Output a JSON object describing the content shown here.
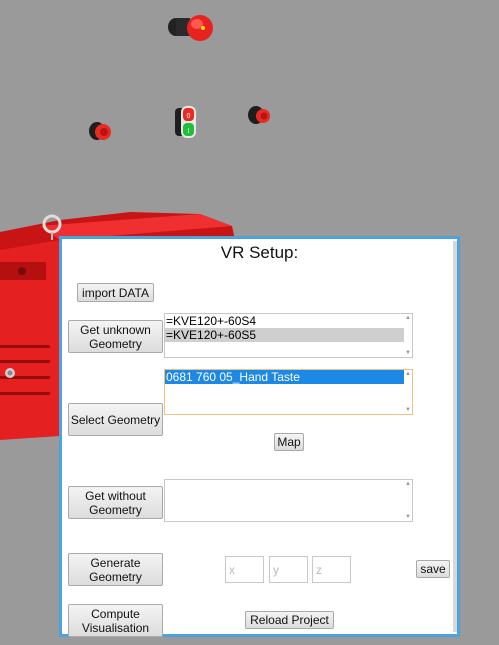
{
  "panel": {
    "title": "VR Setup:",
    "import_label": "import DATA",
    "get_unknown_label": "Get unknown Geometry",
    "unknown_items": [
      "=KVE120+-60S4",
      "=KVE120+-60S5"
    ],
    "select_label": "Select Geometry",
    "selected_items": [
      "0681 760 05_Hand Taste"
    ],
    "map_label": "Map",
    "get_without_label": "Get without Geometry",
    "without_items": [],
    "generate_label": "Generate Geometry",
    "x_placeholder": "x",
    "y_placeholder": "y",
    "z_placeholder": "z",
    "save_label": "save",
    "compute_label": "Compute Visualisation",
    "reload_label": "Reload Project"
  },
  "colors": {
    "scene_background": "#9a9a9a",
    "panel_border": "#4aa3df",
    "selection_blue": "#1e88e5",
    "selection_grey": "#cfcfcf",
    "part_red": "#e02020"
  }
}
